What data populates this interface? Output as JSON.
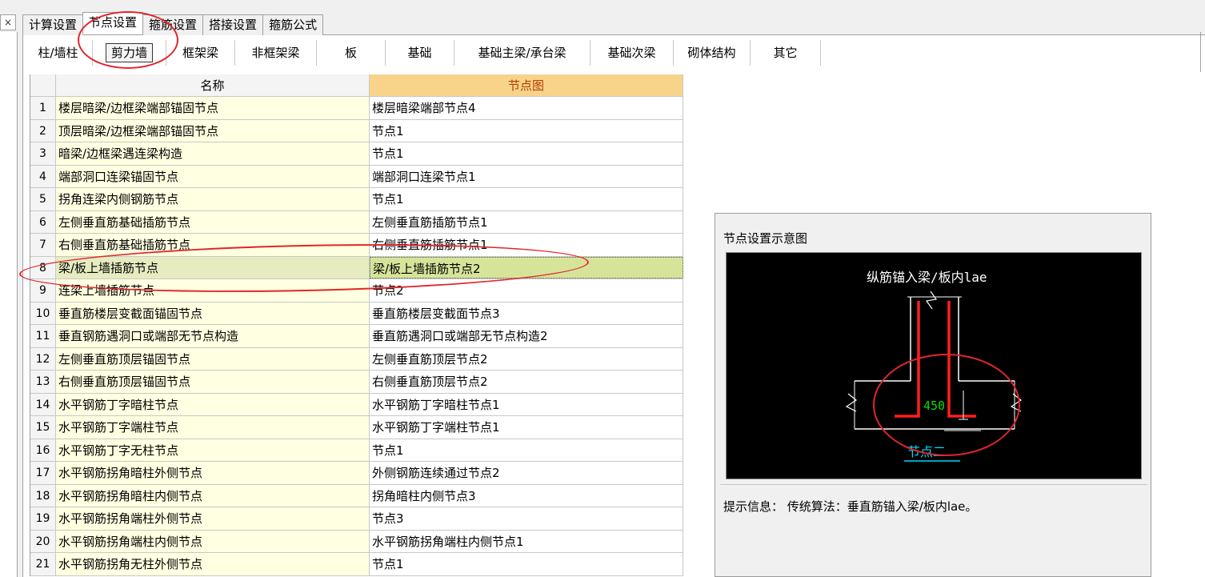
{
  "window": {
    "close_glyph": "×"
  },
  "main_tabs": [
    {
      "label": "计算设置",
      "active": false
    },
    {
      "label": "节点设置",
      "active": true
    },
    {
      "label": "箍筋设置",
      "active": false
    },
    {
      "label": "搭接设置",
      "active": false
    },
    {
      "label": "箍筋公式",
      "active": false
    }
  ],
  "sub_tabs": [
    {
      "label": "柱/墙柱"
    },
    {
      "label": "剪力墙",
      "active": true
    },
    {
      "label": "框架梁"
    },
    {
      "label": "非框架梁"
    },
    {
      "label": "板"
    },
    {
      "label": "基础"
    },
    {
      "label": "基础主梁/承台梁"
    },
    {
      "label": "基础次梁"
    },
    {
      "label": "砌体结构"
    },
    {
      "label": "其它"
    }
  ],
  "grid": {
    "headers": {
      "name": "名称",
      "node": "节点图"
    },
    "rows": [
      {
        "idx": "1",
        "name": "楼层暗梁/边框梁端部锚固节点",
        "node": "楼层暗梁端部节点4"
      },
      {
        "idx": "2",
        "name": "顶层暗梁/边框梁端部锚固节点",
        "node": "节点1"
      },
      {
        "idx": "3",
        "name": "暗梁/边框梁遇连梁构造",
        "node": "节点1"
      },
      {
        "idx": "4",
        "name": "端部洞口连梁锚固节点",
        "node": "端部洞口连梁节点1"
      },
      {
        "idx": "5",
        "name": "拐角连梁内侧钢筋节点",
        "node": "节点1"
      },
      {
        "idx": "6",
        "name": "左侧垂直筋基础插筋节点",
        "node": "左侧垂直筋插筋节点1"
      },
      {
        "idx": "7",
        "name": "右侧垂直筋基础插筋节点",
        "node": "右侧垂直筋插筋节点1"
      },
      {
        "idx": "8",
        "name": "梁/板上墙插筋节点",
        "node": "梁/板上墙插筋节点2",
        "selected": true
      },
      {
        "idx": "9",
        "name": "连梁上墙插筋节点",
        "node": "节点2"
      },
      {
        "idx": "10",
        "name": "垂直筋楼层变截面锚固节点",
        "node": "垂直筋楼层变截面节点3"
      },
      {
        "idx": "11",
        "name": "垂直钢筋遇洞口或端部无节点构造",
        "node": "垂直筋遇洞口或端部无节点构造2"
      },
      {
        "idx": "12",
        "name": "左侧垂直筋顶层锚固节点",
        "node": "左侧垂直筋顶层节点2"
      },
      {
        "idx": "13",
        "name": "右侧垂直筋顶层锚固节点",
        "node": "右侧垂直筋顶层节点2"
      },
      {
        "idx": "14",
        "name": "水平钢筋丁字暗柱节点",
        "node": "水平钢筋丁字暗柱节点1"
      },
      {
        "idx": "15",
        "name": "水平钢筋丁字端柱节点",
        "node": "水平钢筋丁字端柱节点1"
      },
      {
        "idx": "16",
        "name": "水平钢筋丁字无柱节点",
        "node": "节点1"
      },
      {
        "idx": "17",
        "name": "水平钢筋拐角暗柱外侧节点",
        "node": "外侧钢筋连续通过节点2"
      },
      {
        "idx": "18",
        "name": "水平钢筋拐角暗柱内侧节点",
        "node": "拐角暗柱内侧节点3"
      },
      {
        "idx": "19",
        "name": "水平钢筋拐角端柱外侧节点",
        "node": "节点3"
      },
      {
        "idx": "20",
        "name": "水平钢筋拐角端柱内侧节点",
        "node": "水平钢筋拐角端柱内侧节点1"
      },
      {
        "idx": "21",
        "name": "水平钢筋拐角无柱外侧节点",
        "node": "节点1"
      }
    ]
  },
  "preview": {
    "title": "节点设置示意图",
    "diagram_caption": "纵筋锚入梁/板内lae",
    "dimension_label": "450",
    "node_label": "节点二",
    "hint": "提示信息： 传统算法：垂直筋锚入梁/板内lae。"
  },
  "colors": {
    "rebar": "#ff1e1e",
    "outline": "#ffffff",
    "dimension": "#00e000",
    "node_label": "#00d8ff",
    "annotation": "#e0262b"
  }
}
